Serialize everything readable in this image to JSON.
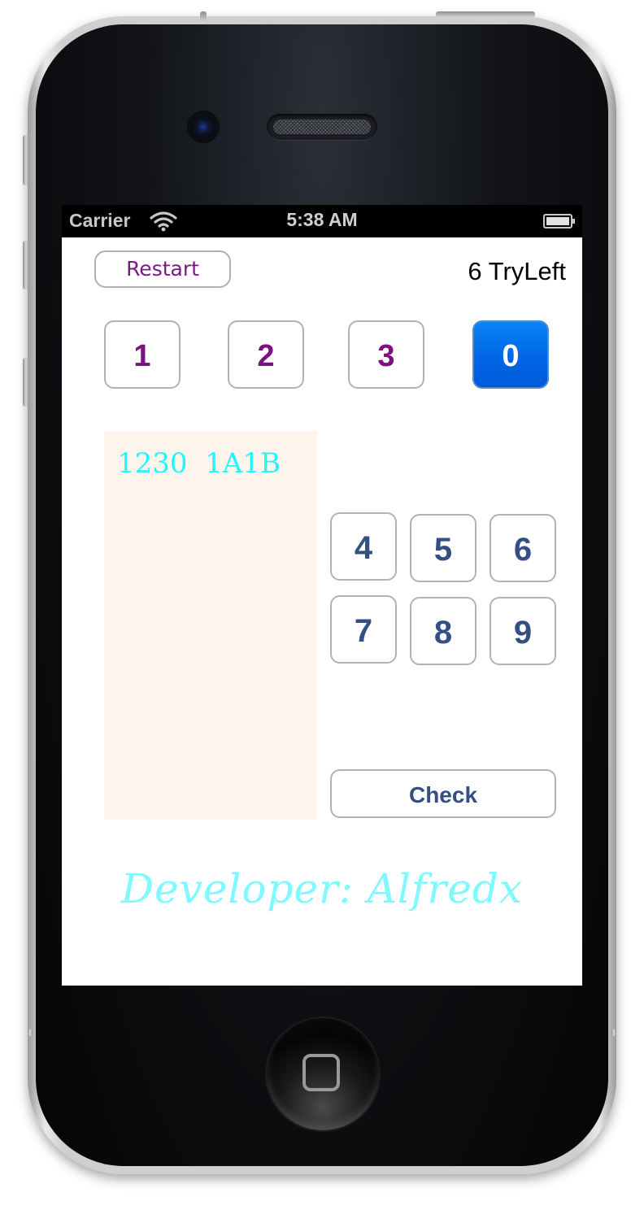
{
  "status_bar": {
    "carrier": "Carrier",
    "time": "5:38 AM",
    "wifi_icon": "wifi-icon",
    "battery_icon": "battery-icon"
  },
  "header": {
    "restart_label": "Restart",
    "tries_left": "6 TryLeft"
  },
  "guess_slots": [
    "1",
    "2",
    "3",
    "0"
  ],
  "active_slot_index": 3,
  "colors": {
    "slot_digit": "#7c1282",
    "active_slot": "#0a7cf0",
    "keypad_digit": "#334f83",
    "history_text": "#1ff7ff",
    "history_bg": "#fdf4ec",
    "developer_text": "#7ef9ff"
  },
  "history": {
    "entries": [
      "1230  1A1B"
    ]
  },
  "keypad": {
    "keys": [
      "4",
      "5",
      "6",
      "7",
      "8",
      "9"
    ],
    "check_label": "Check"
  },
  "footer": {
    "developer": "Developer: Alfredx"
  },
  "device": {
    "home_icon": "home-square-icon"
  }
}
